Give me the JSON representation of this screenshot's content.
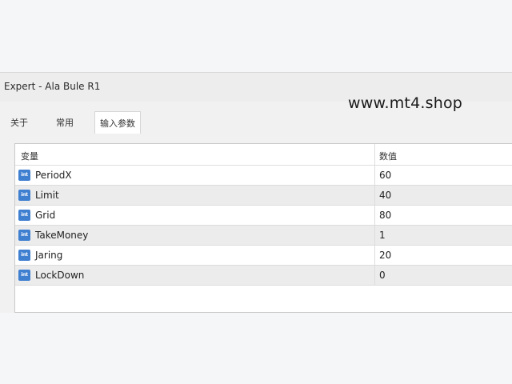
{
  "window": {
    "title": "Expert - Ala Bule R1"
  },
  "watermark": "www.mt4.shop",
  "tabs": [
    {
      "label": "关于",
      "active": false
    },
    {
      "label": "常用",
      "active": false
    },
    {
      "label": "输入参数",
      "active": true
    }
  ],
  "table": {
    "headers": {
      "variable": "变量",
      "value": "数值"
    },
    "type_icon": "int-type-icon",
    "type_icon_text": "int",
    "rows": [
      {
        "name": "PeriodX",
        "value": "60"
      },
      {
        "name": "Limit",
        "value": "40"
      },
      {
        "name": "Grid",
        "value": "80"
      },
      {
        "name": "TakeMoney",
        "value": "1"
      },
      {
        "name": "Jaring",
        "value": "20"
      },
      {
        "name": "LockDown",
        "value": "0"
      }
    ]
  },
  "colors": {
    "icon": "#3f7fd0",
    "row_alt": "#ececec",
    "background": "#f5f6f8"
  }
}
